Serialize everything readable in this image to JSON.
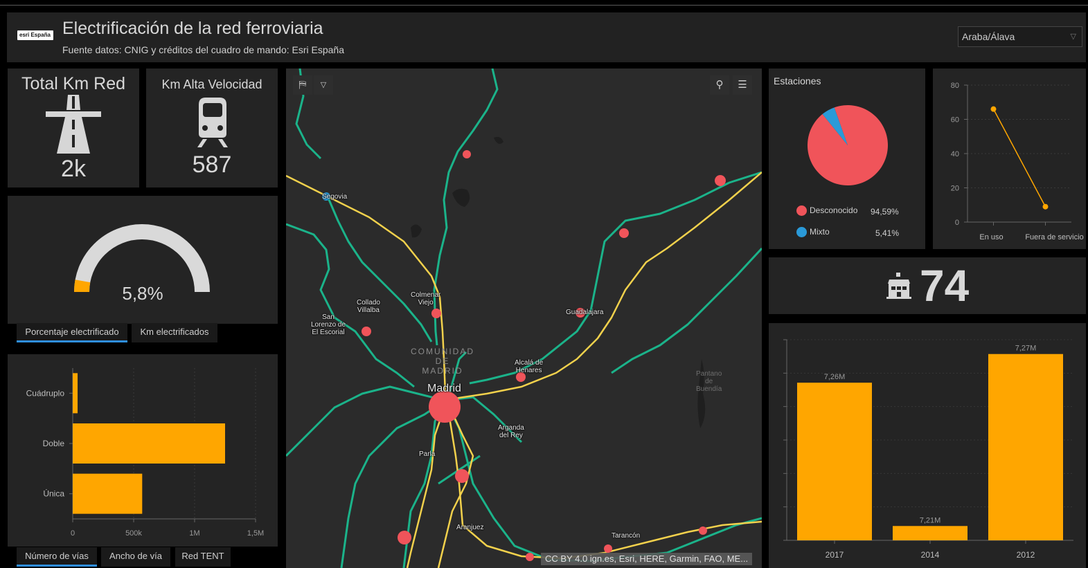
{
  "header": {
    "logo_text": "esri España",
    "title": "Electrificación de la red ferroviaria",
    "subtitle": "Fuente datos: CNIG y créditos del cuadro de mando: Esri España",
    "region_selected": "Araba/Álava"
  },
  "indicators": {
    "total_km": {
      "title": "Total Km Red",
      "value": "2k",
      "icon": "highway-icon"
    },
    "km_av": {
      "title": "Km Alta Velocidad",
      "value": "587",
      "icon": "train-icon"
    },
    "stations_count": {
      "value": "74",
      "icon": "station-building-icon"
    }
  },
  "gauge": {
    "value_label": "5,8%",
    "fraction": 0.058,
    "track_color": "#d9d9d9",
    "fill_color": "#ffa600"
  },
  "gauge_tabs": [
    "Porcentaje electrificado",
    "Km electrificados"
  ],
  "bar_tabs": [
    "Número de vías",
    "Ancho de vía",
    "Red TENT"
  ],
  "map": {
    "attribution": "CC BY 4.0 ign.es, Esri, HERE, Garmin, FAO, ME...",
    "labels": {
      "segovia": "Segovia",
      "collado": "Collado\nVillalba",
      "colmenar": "Colmenar\nViejo",
      "sanlorenzo": "San\nLorenzo de\nEl Escorial",
      "guadalajara": "Guadalajara",
      "comunidad": "COMUNIDAD\nDE\nMADRID",
      "alcala": "Alcalá de\nHenares",
      "madrid": "Madrid",
      "arganda": "Arganda\ndel Rey",
      "parla": "Parla",
      "aranjuez": "Aranjuez",
      "tarancon": "Tarancón",
      "pantano": "Pantano\nde\nBuendía"
    },
    "colors": {
      "electrified": "#1bb38a",
      "high_speed": "#f2d14c",
      "station": "#f0545a",
      "mixed": "#2a9ad8"
    }
  },
  "stations_panel": {
    "title": "Estaciones",
    "legend": [
      {
        "label": "Desconocido",
        "value": "94,59%",
        "color": "#f0545a"
      },
      {
        "label": "Mixto",
        "value": "5,41%",
        "color": "#2a9ad8"
      }
    ]
  },
  "chart_data": [
    {
      "type": "pie",
      "title": "Estaciones",
      "categories": [
        "Desconocido",
        "Mixto"
      ],
      "values": [
        94.59,
        5.41
      ],
      "colors": [
        "#f0545a",
        "#2a9ad8"
      ]
    },
    {
      "type": "line",
      "categories": [
        "En uso",
        "Fuera de servicio"
      ],
      "values": [
        66,
        9
      ],
      "ylim": [
        0,
        80
      ],
      "yticks": [
        "0",
        "20",
        "40",
        "60",
        "80"
      ],
      "color": "#ffa600"
    },
    {
      "type": "bar",
      "orientation": "horizontal",
      "categories": [
        "Cuádruplo",
        "Doble",
        "Única"
      ],
      "values": [
        40000,
        1250000,
        570000
      ],
      "xlim": [
        0,
        1500000
      ],
      "xticks": [
        "0",
        "500k",
        "1M",
        "1,5M"
      ],
      "color": "#ffa600"
    },
    {
      "type": "bar",
      "categories": [
        "2017",
        "2014",
        "2012"
      ],
      "values": [
        7.26,
        7.21,
        7.27
      ],
      "data_labels": [
        "7,26M",
        "7,21M",
        "7,27M"
      ],
      "color": "#ffa600"
    }
  ]
}
